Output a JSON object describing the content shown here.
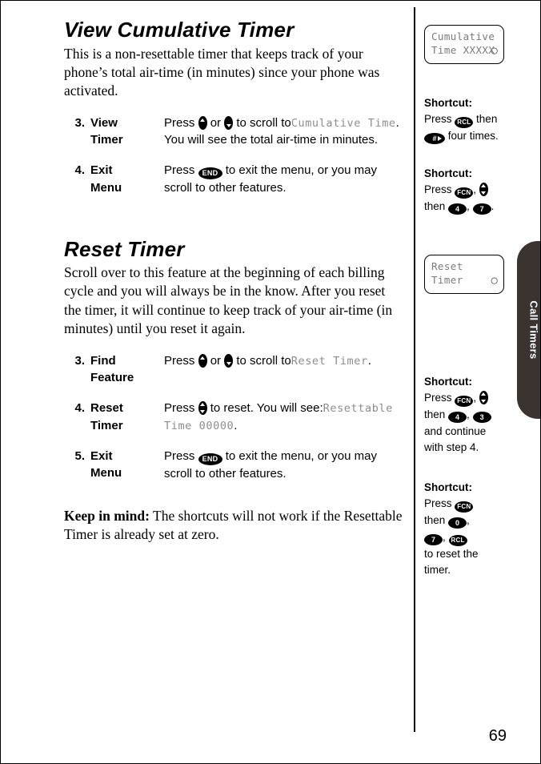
{
  "page": {
    "number": "69",
    "side_tab_label": "Call Timers"
  },
  "sections": [
    {
      "title": "View Cumulative Timer",
      "intro": "This is a non-resettable timer that keeps track of your phone’s total air-time (in minutes) since your phone was activated.",
      "steps": [
        {
          "num": "3.",
          "name_line1": "View",
          "name_line2": "Timer",
          "desc_pre": "Press",
          "desc_mid": "or",
          "desc_post": "to scroll to",
          "lcd": "Cumulative Time",
          "desc_tail": ".",
          "desc_line2": "You will see the total air-time in minutes."
        },
        {
          "num": "4.",
          "name_line1": "Exit",
          "name_line2": "Menu",
          "desc_pre": "Press",
          "key": "END",
          "desc_post": "to exit the menu, or you may scroll to other features."
        }
      ]
    },
    {
      "title": "Reset Timer",
      "intro": "Scroll over to this feature at the beginning of each billing cycle and you will always be in the know. After you reset the timer, it will continue to keep track of your air-time (in minutes) until you reset it again.",
      "steps": [
        {
          "num": "3.",
          "name_line1": "Find",
          "name_line2": "Feature",
          "desc_pre": "Press",
          "desc_mid": "or",
          "desc_post": "to scroll to",
          "lcd": "Reset Timer",
          "desc_tail": "."
        },
        {
          "num": "4.",
          "name_line1": "Reset",
          "name_line2": "Timer",
          "desc_pre": "Press",
          "desc_post": "to reset. You will see:",
          "lcd": "Resettable Time 00000",
          "desc_tail": "."
        },
        {
          "num": "5.",
          "name_line1": "Exit",
          "name_line2": "Menu",
          "desc_pre": "Press",
          "key": "END",
          "desc_post": "to exit the menu, or you may scroll to other features."
        }
      ],
      "keep_in_mind_label": "Keep in mind:",
      "keep_in_mind_text": "The shortcuts will not work if the Resettable Timer is already set at zero."
    }
  ],
  "sidebar": {
    "lcd_cumulative": {
      "line1": "Cumulative",
      "line2": "Time XXXXX",
      "clock_icon": "clock-icon"
    },
    "lcd_reset": {
      "line1": "Reset",
      "line2": "Timer",
      "clock_icon": "clock-icon"
    },
    "shortcuts": [
      {
        "head": "Shortcut:",
        "press_label": "Press",
        "key1": "RCL",
        "then_label": "then",
        "key2": "#",
        "tail": "four times."
      },
      {
        "head": "Shortcut:",
        "press_label": "Press",
        "key1": "FCN",
        "comma": ",",
        "then_label": "then",
        "key2": "4",
        "key3": "7",
        "tail": "."
      },
      {
        "head": "Shortcut:",
        "press_label": "Press",
        "key1": "FCN",
        "comma": ",",
        "then_label": "then",
        "key2": "4",
        "key3": "3",
        "tail_line1": "and continue",
        "tail_line2": "with step 4."
      },
      {
        "head": "Shortcut:",
        "press_label": "Press",
        "key1": "FCN",
        "then_label": "then",
        "key2": "0",
        "key3": "7",
        "key4": "RCL",
        "tail_line1": "to reset the",
        "tail_line2": "timer."
      }
    ]
  }
}
